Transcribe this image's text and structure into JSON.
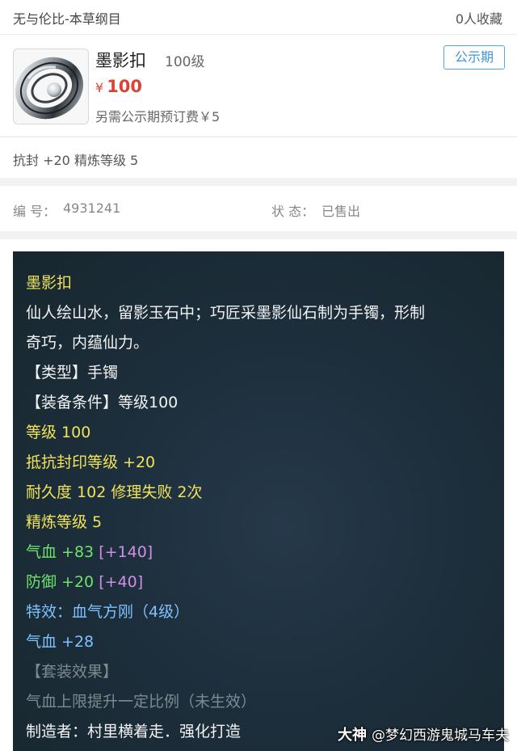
{
  "header": {
    "seller_title": "无与伦比-本草纲目",
    "favorites": "0人收藏"
  },
  "item": {
    "name": "墨影扣",
    "level": "100级",
    "price_symbol": "¥",
    "price": "100",
    "extra_fee": "另需公示期预订费￥5",
    "status_badge": "公示期",
    "attributes_summary": "抗封 +20 精炼等级 5"
  },
  "info": {
    "id_label": "编 号：",
    "id_value": "4931241",
    "status_label": "状 态：",
    "status_value": "已售出"
  },
  "details": {
    "name": "墨影扣",
    "desc1": "仙人绘山水，留影玉石中；巧匠采墨影仙石制为手镯，形制",
    "desc2": "奇巧，内蕴仙力。",
    "type": "【类型】手镯",
    "requirement": "【装备条件】等级100",
    "level": "等级 100",
    "seal_resist": "抵抗封印等级 +20",
    "durability": "耐久度 102 修理失败 2次",
    "refine": "精炼等级 5",
    "hp_base": "气血 +83",
    "hp_bonus": "[+140]",
    "def_base": "防御 +20",
    "def_bonus": "[+40]",
    "special_effect": "特效：血气方刚（4级）",
    "hp_extra": "气血 +28",
    "set_label": "【套装效果】",
    "set_effect": "气血上限提升一定比例（未生效）",
    "maker": "制造者：村里横着走．强化打造"
  },
  "watermark": {
    "brand": "大神",
    "handle": "@梦幻西游鬼城马车夫"
  },
  "colors": {
    "price": "#d9443a",
    "badge": "#3f97d4",
    "panel_bg": "#1d2f3c",
    "yellow_text": "#f0e35a",
    "green_text": "#6fe36b",
    "purple_text": "#d38ee6",
    "blue_text": "#7fc0ff",
    "gray_text": "#7d8a90"
  }
}
